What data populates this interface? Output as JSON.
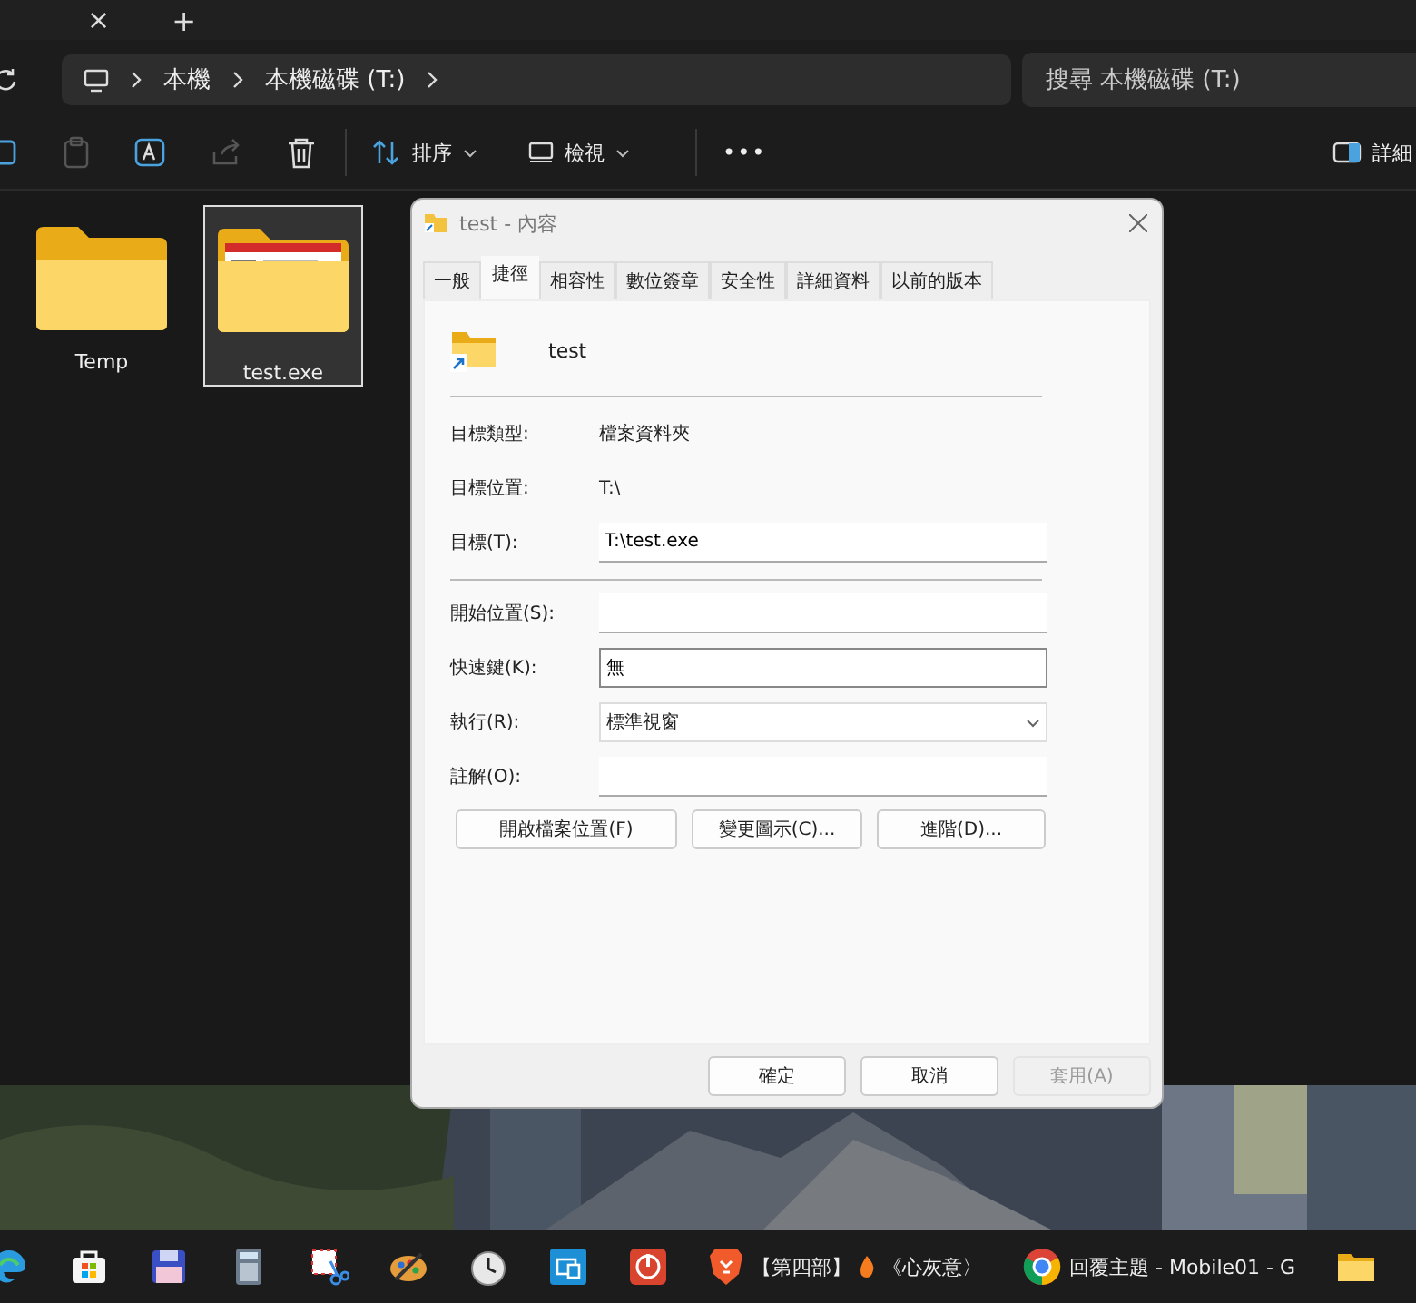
{
  "explorer": {
    "tab_close": "×",
    "new_tab": "+",
    "breadcrumb": [
      "本機",
      "本機磁碟 (T:)"
    ],
    "search": {
      "placeholder": "搜尋 本機磁碟 (T:)"
    },
    "toolbar": {
      "sort": "排序",
      "view": "檢視",
      "more": "•••",
      "details": "詳細"
    },
    "files": [
      {
        "name": "Temp",
        "kind": "folder",
        "selected": false
      },
      {
        "name": "test.exe",
        "kind": "thumbnail",
        "selected": true
      }
    ]
  },
  "dialog": {
    "title": "test - 內容",
    "tabs": [
      {
        "label": "一般",
        "selected": false
      },
      {
        "label": "捷徑",
        "selected": true
      },
      {
        "label": "相容性",
        "selected": false
      },
      {
        "label": "數位簽章",
        "selected": false
      },
      {
        "label": "安全性",
        "selected": false
      },
      {
        "label": "詳細資料",
        "selected": false
      },
      {
        "label": "以前的版本",
        "selected": false
      }
    ],
    "item_name": "test",
    "info": [
      {
        "label": "目標類型:",
        "value": "檔案資料夾"
      },
      {
        "label": "目標位置:",
        "value": "T:\\"
      }
    ],
    "target": {
      "label": "目標(T):",
      "value": "T:\\test.exe"
    },
    "fields": [
      {
        "label": "開始位置(S):",
        "kind": "input"
      },
      {
        "label": "快速鍵(K):",
        "kind": "hotkey",
        "value": "無"
      },
      {
        "label": "執行(R):",
        "kind": "select",
        "value": "標準視窗"
      },
      {
        "label": "註解(O):",
        "kind": "input"
      }
    ],
    "buttons": [
      "開啟檔案位置(F)",
      "變更圖示(C)...",
      "進階(D)..."
    ],
    "footer": [
      {
        "label": "確定",
        "disabled": false
      },
      {
        "label": "取消",
        "disabled": false
      },
      {
        "label": "套用(A)",
        "disabled": true
      }
    ]
  },
  "taskbar": {
    "apps": [
      {
        "kind": "edge"
      },
      {
        "kind": "store"
      },
      {
        "kind": "floppy"
      },
      {
        "kind": "calculator"
      },
      {
        "kind": "snip"
      },
      {
        "kind": "palette"
      },
      {
        "kind": "clock"
      },
      {
        "kind": "remote"
      },
      {
        "kind": "power"
      },
      {
        "kind": "brave",
        "label_before": "【第四部】",
        "label_after": "《心灰意〉"
      },
      {
        "kind": "chrome",
        "label": "回覆主題 - Mobile01 - G"
      },
      {
        "kind": "folder"
      }
    ]
  }
}
